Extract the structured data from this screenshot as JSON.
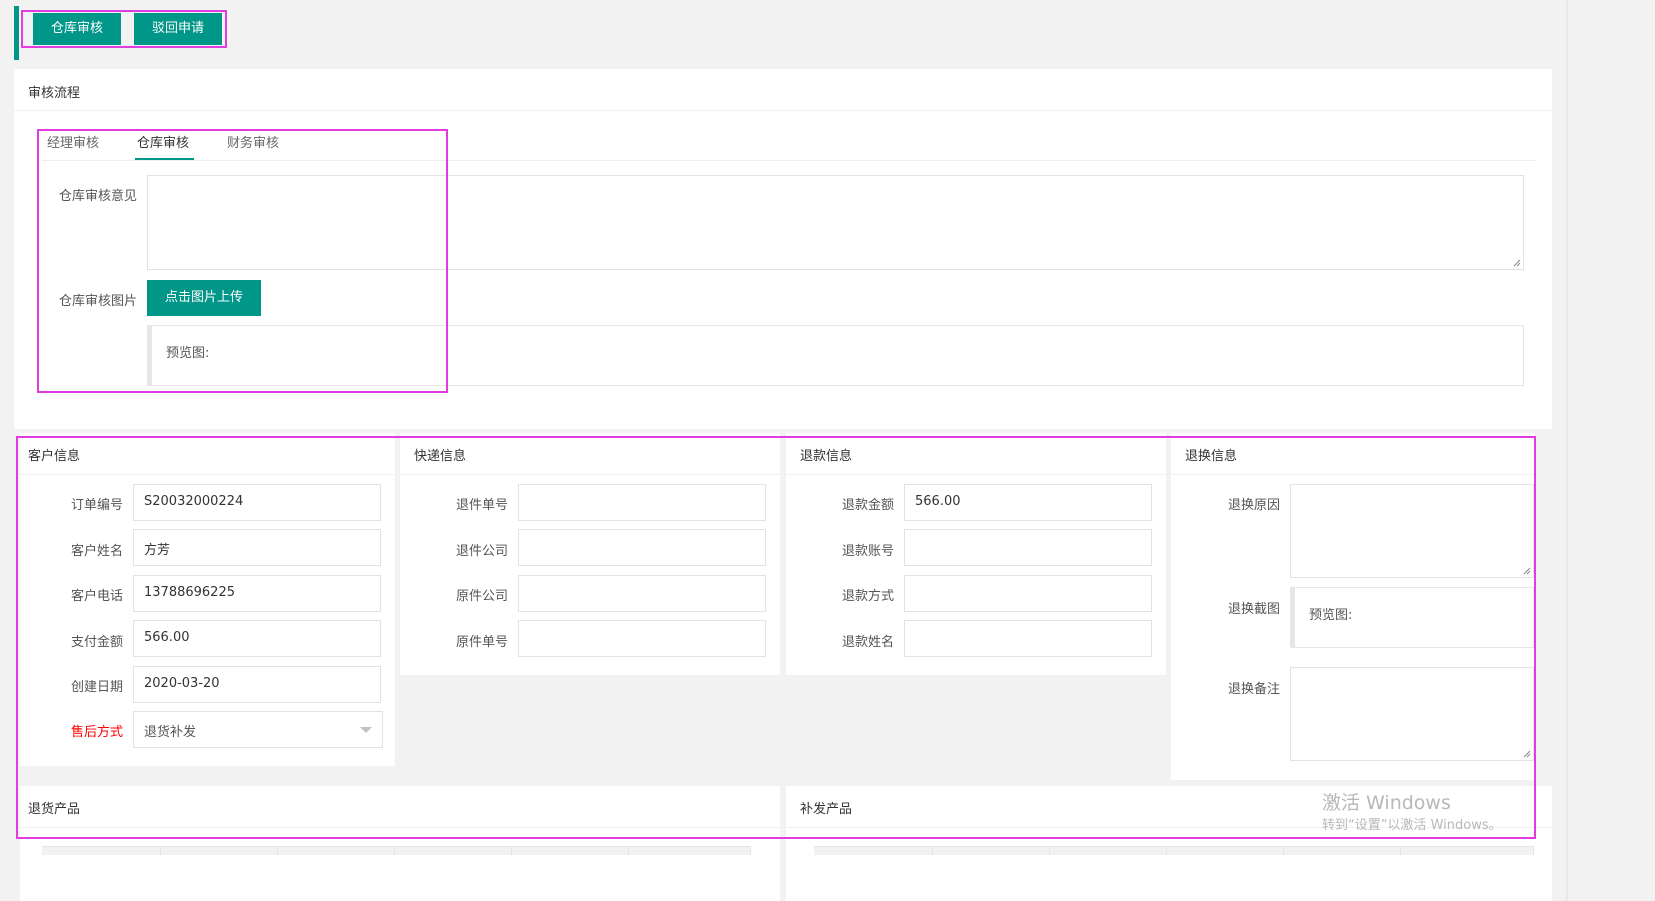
{
  "toolbar": {
    "warehouse_review_btn": "仓库审核",
    "reject_btn": "驳回申请"
  },
  "review_flow": {
    "title": "审核流程",
    "tabs": [
      "经理审核",
      "仓库审核",
      "财务审核"
    ],
    "active_tab_index": 1,
    "opinion_label": "仓库审核意见",
    "opinion_value": "",
    "image_label": "仓库审核图片",
    "upload_btn": "点击图片上传",
    "preview_label": "预览图:"
  },
  "customer": {
    "title": "客户信息",
    "fields": [
      {
        "label": "订单编号",
        "value": "S20032000224"
      },
      {
        "label": "客户姓名",
        "value": "方芳"
      },
      {
        "label": "客户电话",
        "value": "13788696225"
      },
      {
        "label": "支付金额",
        "value": "566.00"
      },
      {
        "label": "创建日期",
        "value": "2020-03-20"
      }
    ],
    "aftersale_label": "售后方式",
    "aftersale_value": "退货补发"
  },
  "express": {
    "title": "快递信息",
    "fields": [
      {
        "label": "退件单号",
        "value": ""
      },
      {
        "label": "退件公司",
        "value": ""
      },
      {
        "label": "原件公司",
        "value": ""
      },
      {
        "label": "原件单号",
        "value": ""
      }
    ]
  },
  "refund": {
    "title": "退款信息",
    "fields": [
      {
        "label": "退款金额",
        "value": "566.00"
      },
      {
        "label": "退款账号",
        "value": ""
      },
      {
        "label": "退款方式",
        "value": ""
      },
      {
        "label": "退款姓名",
        "value": ""
      }
    ]
  },
  "exchange": {
    "title": "退换信息",
    "reason_label": "退换原因",
    "screenshot_label": "退换截图",
    "preview_label": "预览图:",
    "remark_label": "退换备注"
  },
  "return_products": {
    "title": "退货产品"
  },
  "reissue_products": {
    "title": "补发产品"
  },
  "watermark": {
    "line1": "激活 Windows",
    "line2": "转到“设置”以激活 Windows。"
  },
  "colors": {
    "primary": "#009688",
    "highlight": "#e03ce0",
    "required": "#ff0000"
  }
}
